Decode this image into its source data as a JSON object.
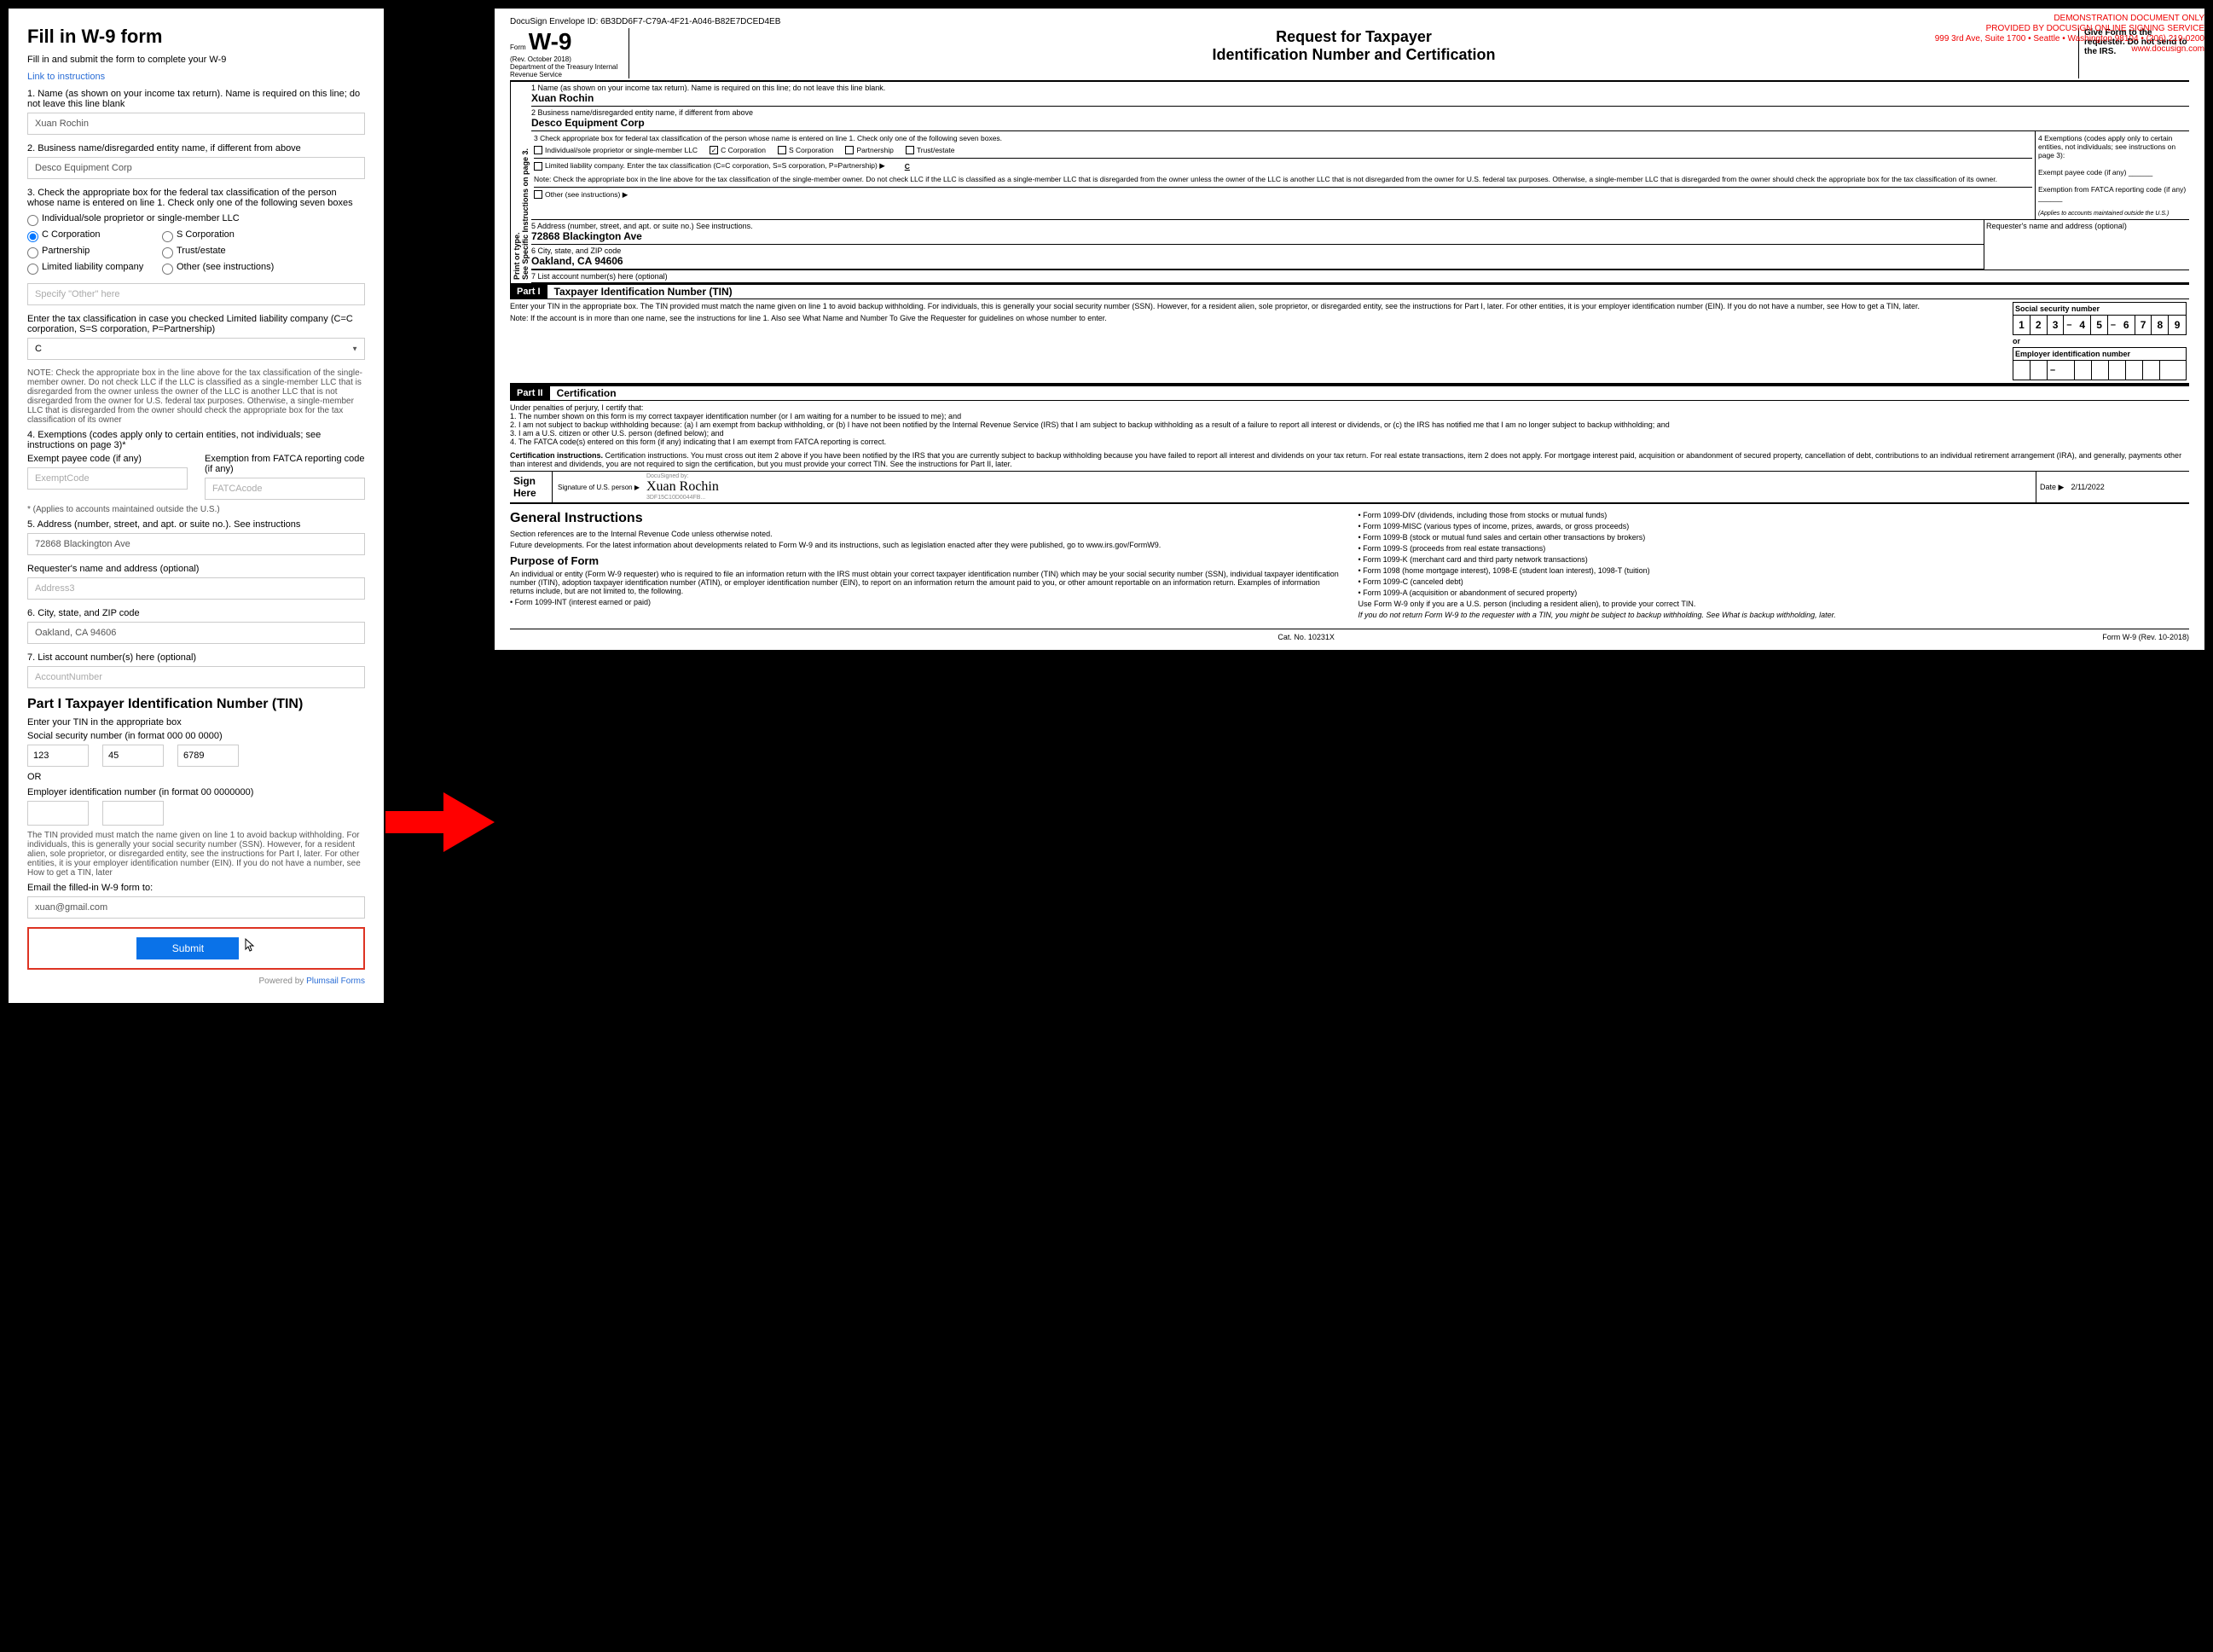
{
  "form": {
    "title": "Fill in W-9 form",
    "subtitle": "Fill in and submit the form to complete your W-9",
    "link": "Link to instructions",
    "q1_label": "1. Name (as shown on your income tax return). Name is required on this line; do not leave this line blank",
    "q1_value": "Xuan Rochin",
    "q2_label": "2. Business name/disregarded entity name, if different from above",
    "q2_value": "Desco Equipment Corp",
    "q3_label": "3. Check the appropriate box for the federal tax classification of the person whose name is entered on line 1. Check only one of the following seven boxes",
    "r1": "Individual/sole proprietor or single-member LLC",
    "r2": "C Corporation",
    "r3": "S Corporation",
    "r4": "Partnership",
    "r5": "Trust/estate",
    "r6": "Limited liability company",
    "r7": "Other (see instructions)",
    "other_ph": "Specify \"Other\" here",
    "llc_label": "Enter the tax classification in case you checked Limited liability company (C=C corporation, S=S corporation, P=Partnership)",
    "llc_value": "C",
    "note": "NOTE: Check the appropriate box in the line above for the tax classification of the single-member owner.  Do not check LLC if the LLC is classified as a single-member LLC that is disregarded from the owner unless the owner of the LLC is another LLC that is not disregarded from the owner for U.S. federal tax purposes. Otherwise, a single-member LLC that is disregarded from the owner should check the appropriate box for the tax classification of its owner",
    "q4_label": "4. Exemptions (codes apply only to certain entities, not individuals; see instructions on page 3)*",
    "exempt_label": "Exempt payee code (if any)",
    "exempt_ph": "ExemptCode",
    "fatca_label": "Exemption from FATCA reporting  code (if any)",
    "fatca_ph": "FATCAcode",
    "applies": "* (Applies to accounts maintained outside the U.S.)",
    "q5_label": "5. Address (number, street, and apt. or suite no.). See instructions",
    "q5_value": "72868 Blackington Ave",
    "req_label": "Requester's name and address (optional)",
    "req_ph": "Address3",
    "q6_label": "6. City, state, and ZIP code",
    "q6_value": "Oakland, CA 94606",
    "q7_label": "7. List account number(s) here (optional)",
    "q7_ph": "AccountNumber",
    "part1_h": "Part I Taxpayer Identification Number (TIN)",
    "part1_sub": "Enter your TIN in the appropriate box",
    "ssn_label": "Social security number (in format 000 00 0000)",
    "ssn1": "123",
    "ssn2": "45",
    "ssn3": "6789",
    "or": "OR",
    "ein_label": "Employer identification number (in format 00 0000000)",
    "tin_note": "The TIN provided must match the name given on line 1 to avoid backup withholding. For individuals, this is generally your social security number (SSN). However, for a resident alien, sole proprietor, or disregarded entity, see the instructions for Part I, later. For other entities, it is your employer identification number (EIN). If you do not have a number, see How to get a TIN, later",
    "email_label": "Email the filled-in W-9 form to:",
    "email_value": "xuan@gmail.com",
    "submit": "Submit",
    "powered_pre": "Powered by ",
    "powered_link": "Plumsail Forms"
  },
  "doc": {
    "envelope": "DocuSign Envelope ID: 6B3DD6F7-C79A-4F21-A046-B82E7DCED4EB",
    "demo1": "DEMONSTRATION DOCUMENT ONLY",
    "demo2": "PROVIDED BY DOCUSIGN ONLINE SIGNING SERVICE",
    "demo3": "999 3rd Ave, Suite 1700 • Seattle • Washington 98104 • (206) 219-0200",
    "demo4": "www.docusign.com",
    "form_label": "Form",
    "w9": "W-9",
    "rev": "(Rev. October 2018)",
    "dept": "Department of the Treasury Internal Revenue Service",
    "title1": "Request for Taxpayer",
    "title2": "Identification Number and Certification",
    "give": "Give Form to the requester. Do not send to the IRS.",
    "side_label": "Print or type.\nSee Specific Instructions on page 3.",
    "l1": "1  Name (as shown on your income tax return). Name is required on this line; do not leave this line blank.",
    "l1v": "Xuan Rochin",
    "l2": "2  Business name/disregarded entity name, if different from above",
    "l2v": "Desco Equipment Corp",
    "l3": "3  Check appropriate box for federal tax classification of the person whose name is entered on line 1. Check only one of the following seven boxes.",
    "c1": "Individual/sole proprietor or single-member LLC",
    "c2": "C Corporation",
    "c3": "S Corporation",
    "c4": "Partnership",
    "c5": "Trust/estate",
    "llc_text": "Limited liability company. Enter the tax classification (C=C corporation, S=S corporation, P=Partnership) ▶",
    "llc_v": "C",
    "llc_note": "Note: Check the appropriate box in the line above for the tax classification of the single-member owner.  Do not check LLC if the LLC is classified as a single-member LLC that is disregarded from the owner unless the owner of the LLC is another LLC that is not disregarded from the owner for U.S. federal tax purposes. Otherwise, a single-member LLC that is disregarded from the owner should check the appropriate box for the tax classification of its owner.",
    "other": "Other (see instructions) ▶",
    "l4": "4  Exemptions (codes apply only to certain entities, not individuals; see instructions on page 3):",
    "l4a": "Exempt payee code (if any) ______",
    "l4b": "Exemption from FATCA reporting code (if any) ______",
    "l4c": "(Applies to accounts maintained outside the U.S.)",
    "l5": "5  Address (number, street, and apt. or suite no.) See instructions.",
    "l5v": "72868 Blackington Ave",
    "req": "Requester's name and address (optional)",
    "l6": "6  City, state, and ZIP code",
    "l6v": "Oakland, CA 94606",
    "l7": "7  List account number(s) here (optional)",
    "part1": "Part I",
    "part1_t": "Taxpayer Identification Number (TIN)",
    "tin_text": "Enter your TIN in the appropriate box. The TIN provided must match the name given on line 1 to avoid backup withholding. For individuals, this is generally your social security number (SSN). However, for a resident alien, sole proprietor, or disregarded entity, see the instructions for Part I, later. For other entities, it is your employer identification number (EIN). If you do not have a number, see How to get a TIN, later.",
    "tin_note2": "Note: If the account is in more than one name, see the instructions for line 1. Also see What Name and Number To Give the Requester for guidelines on whose number to enter.",
    "ssn_h": "Social security number",
    "ssn_digits": [
      "1",
      "2",
      "3",
      "4",
      "5",
      "6",
      "7",
      "8",
      "9"
    ],
    "or": "or",
    "ein_h": "Employer identification number",
    "part2": "Part II",
    "part2_t": "Certification",
    "cert_intro": "Under penalties of perjury, I certify that:",
    "cert1": "1. The number shown on this form is my correct taxpayer identification number (or I am waiting for a number to be issued to me); and",
    "cert2": "2. I am not subject to backup withholding because: (a) I am exempt from backup withholding, or (b) I have not been notified by the Internal Revenue Service (IRS) that I am subject to backup withholding as a result of a failure to report all interest or dividends, or (c) the IRS has notified me that I am no longer subject to backup withholding; and",
    "cert3": "3. I am a U.S. citizen or other U.S. person (defined below); and",
    "cert4": "4. The FATCA code(s) entered on this form (if any) indicating that I am exempt from FATCA reporting is correct.",
    "cert_instr": "Certification instructions. You must cross out item 2 above if you have been notified by the IRS that you are currently subject to backup withholding because you have failed to report all interest and dividends on your tax return. For real estate transactions, item 2 does not apply. For mortgage interest paid, acquisition or abandonment of secured property, cancellation of debt, contributions to an individual retirement arrangement (IRA), and generally, payments other than interest and dividends, you are not required to sign the certification, but you must provide your correct TIN. See the instructions for Part II, later.",
    "sign_here": "Sign Here",
    "sig_label": "Signature of U.S. person ▶",
    "signature": "Xuan Rochin",
    "ds_by": "DocuSigned by:",
    "ds_id": "3DF15C10D0044FB...",
    "date_label": "Date ▶",
    "date": "2/11/2022",
    "gi_h": "General Instructions",
    "gi_p1": "Section references are to the Internal Revenue Code unless otherwise noted.",
    "gi_p2": "Future developments. For the latest information about developments related to Form W-9 and its instructions, such as legislation enacted after they were published, go to www.irs.gov/FormW9.",
    "purpose_h": "Purpose of Form",
    "purpose_p": "An individual or entity (Form W-9 requester) who is required to file an information return with the IRS must obtain your correct taxpayer identification number (TIN) which may be your social security number (SSN), individual taxpayer identification number (ITIN), adoption taxpayer identification number (ATIN), or employer identification number (EIN), to report on an information return the amount paid to you, or other amount reportable on an information return. Examples of information returns include, but are not limited to, the following.",
    "b1": "• Form 1099-INT (interest earned or paid)",
    "b2": "• Form 1099-DIV (dividends, including those from stocks or mutual funds)",
    "b3": "• Form 1099-MISC (various types of income, prizes, awards, or gross proceeds)",
    "b4": "• Form 1099-B (stock or mutual fund sales and certain other transactions by brokers)",
    "b5": "• Form 1099-S (proceeds from real estate transactions)",
    "b6": "• Form 1099-K (merchant card and third party network transactions)",
    "b7": "• Form 1098 (home mortgage interest), 1098-E (student loan interest), 1098-T (tuition)",
    "b8": "• Form 1099-C (canceled debt)",
    "b9": "• Form 1099-A (acquisition or abandonment of secured property)",
    "use_p": "   Use Form W-9 only if you are a U.S. person (including a resident alien), to provide your correct TIN.",
    "warn_p": "   If you do not return Form W-9 to the requester with a TIN, you might be subject to backup withholding. See What is backup withholding, later.",
    "cat": "Cat. No. 10231X",
    "foot": "Form W-9 (Rev. 10-2018)"
  }
}
